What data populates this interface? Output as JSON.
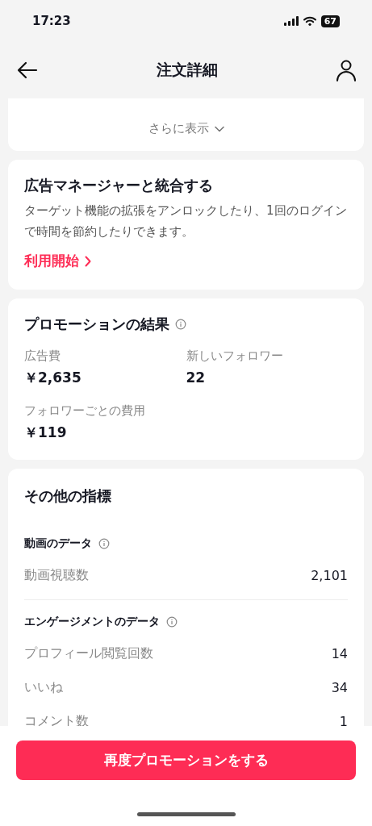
{
  "status_bar": {
    "time": "17:23",
    "battery": "67"
  },
  "header": {
    "title": "注文詳細"
  },
  "summary_card": {
    "more_link": "さらに表示"
  },
  "integration_card": {
    "title": "広告マネージャーと統合する",
    "description": "ターゲット機能の拡張をアンロックしたり、1回のログインで時間を節約したりできます。",
    "link": "利用開始"
  },
  "results_card": {
    "title": "プロモーションの結果",
    "metrics": [
      {
        "label": "広告費",
        "value": "￥2,635"
      },
      {
        "label": "新しいフォロワー",
        "value": "22"
      },
      {
        "label": "フォロワーごとの費用",
        "value": "￥119"
      }
    ]
  },
  "metrics_card": {
    "title": "その他の指標",
    "sections": [
      {
        "heading": "動画のデータ",
        "rows": [
          {
            "label": "動画視聴数",
            "value": "2,101"
          }
        ]
      },
      {
        "heading": "エンゲージメントのデータ",
        "rows": [
          {
            "label": "プロフィール閲覧回数",
            "value": "14"
          },
          {
            "label": "いいね",
            "value": "34"
          },
          {
            "label": "コメント数",
            "value": "1"
          }
        ]
      }
    ]
  },
  "action_button": {
    "label": "再度プロモーションをする"
  }
}
